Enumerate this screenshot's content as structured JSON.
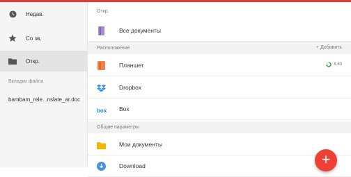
{
  "sidebar": {
    "items": [
      {
        "label": "Недав.",
        "icon": "clock-icon"
      },
      {
        "label": "Со зв.",
        "icon": "star-icon"
      },
      {
        "label": "Откр.",
        "icon": "folder-icon"
      }
    ],
    "caption": "Вкладки файла",
    "file": "bambam_rele...nslate_ar.doc"
  },
  "main": {
    "open_header": "Откр.",
    "all_docs": "Все документы",
    "location_header": "Расположение",
    "add_label": "+ Добавить",
    "locations": [
      {
        "label": "Планшет",
        "icon": "tablet-icon",
        "meta": "8,80"
      },
      {
        "label": "Dropbox",
        "icon": "dropbox-icon"
      },
      {
        "label": "Box",
        "icon": "box-icon"
      }
    ],
    "common_header": "Общие параметры",
    "common": [
      {
        "label": "Мои документы",
        "icon": "folder-icon"
      },
      {
        "label": "Download",
        "icon": "download-icon"
      }
    ]
  },
  "fab": "+",
  "colors": {
    "accent": "#e53935",
    "fab": "#ef4036"
  }
}
